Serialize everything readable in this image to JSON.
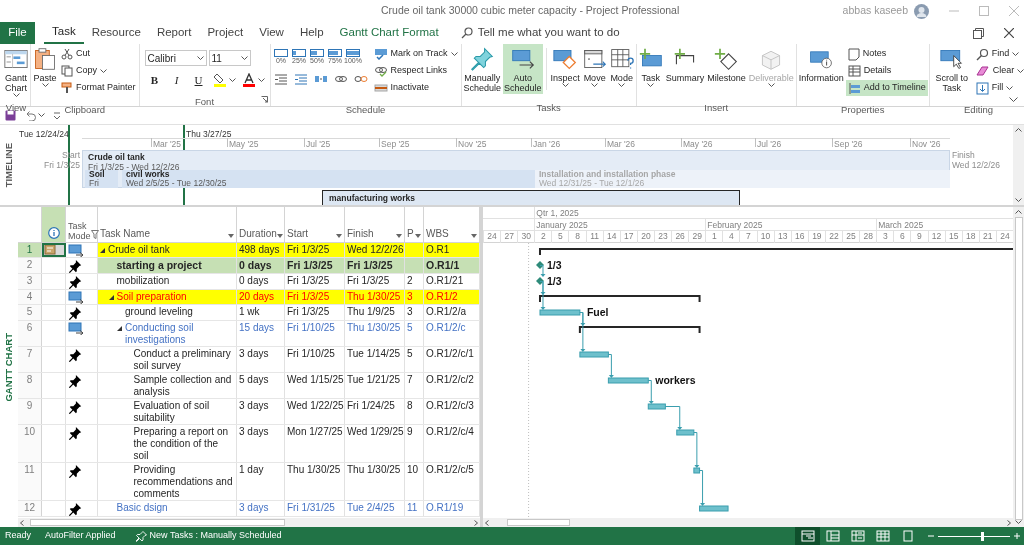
{
  "window": {
    "title": "Crude oil tank 30000 cubic meter capacity - Project Professional",
    "user": "abbas kaseeb"
  },
  "menu_tabs": [
    {
      "label": "File",
      "kind": "file",
      "selected": false
    },
    {
      "label": "Task",
      "kind": "tab",
      "selected": true
    },
    {
      "label": "Resource",
      "kind": "tab",
      "selected": false
    },
    {
      "label": "Report",
      "kind": "tab",
      "selected": false
    },
    {
      "label": "Project",
      "kind": "tab",
      "selected": false
    },
    {
      "label": "View",
      "kind": "tab",
      "selected": false
    },
    {
      "label": "Help",
      "kind": "tab",
      "selected": false
    },
    {
      "label": "Gantt Chart Format",
      "kind": "contextual",
      "selected": false
    }
  ],
  "search": {
    "placeholder": "Tell me what you want to do"
  },
  "ribbon": [
    {
      "kind": "view",
      "label": "View",
      "items": [
        {
          "label": "Gantt Chart",
          "dropdown": true
        }
      ]
    },
    {
      "kind": "clipboard",
      "label": "Clipboard",
      "items": [
        {
          "label": "Paste",
          "dropdown": true
        },
        {
          "label": "Cut",
          "dropdown": false
        },
        {
          "label": "Copy",
          "dropdown": true
        },
        {
          "label": "Format Painter",
          "dropdown": false
        }
      ]
    },
    {
      "kind": "font",
      "label": "Font",
      "font": "Calibri",
      "size": "11",
      "styles": [
        "B",
        "I",
        "U"
      ]
    },
    {
      "kind": "schedule",
      "label": "Schedule",
      "percents": [
        "0%",
        "25%",
        "50%",
        "75%",
        "100%"
      ],
      "items": [
        {
          "label": "Mark on Track",
          "dropdown": true
        },
        {
          "label": "Respect Links",
          "dropdown": false
        },
        {
          "label": "Inactivate",
          "dropdown": false
        }
      ]
    },
    {
      "kind": "tasks",
      "label": "Tasks",
      "items": [
        {
          "label": "Manually Schedule",
          "selected": false
        },
        {
          "label": "Auto Schedule",
          "selected": true
        },
        {
          "label": "Inspect",
          "selected": false,
          "dropdown": true
        },
        {
          "label": "Move",
          "selected": false,
          "dropdown": true
        },
        {
          "label": "Mode",
          "selected": false,
          "dropdown": true
        }
      ]
    },
    {
      "kind": "insert",
      "label": "Insert",
      "items": [
        {
          "label": "Task",
          "disabled": false,
          "dropdown": true
        },
        {
          "label": "Summary",
          "disabled": false,
          "dropdown": false
        },
        {
          "label": "Milestone",
          "disabled": false,
          "dropdown": false
        },
        {
          "label": "Deliverable",
          "disabled": true,
          "dropdown": true
        }
      ]
    },
    {
      "kind": "properties",
      "label": "Properties",
      "items": [
        {
          "label": "Information",
          "selected": false
        },
        {
          "label": "Notes",
          "selected": false
        },
        {
          "label": "Details",
          "selected": false
        },
        {
          "label": "Add to Timeline",
          "selected": true
        }
      ]
    },
    {
      "kind": "editing",
      "label": "Editing",
      "items": [
        {
          "label": "Scroll to Task",
          "dropdown": false
        },
        {
          "label": "Find",
          "dropdown": true
        },
        {
          "label": "Clear",
          "dropdown": true
        },
        {
          "label": "Fill",
          "dropdown": true
        }
      ]
    }
  ],
  "timeline": {
    "label": "TIMELINE",
    "range_start": "Tue 12/24/24",
    "range_end": "Thu 3/27/25",
    "months": [
      "Mar '25",
      "May '25",
      "Jul '25",
      "Sep '25",
      "Nov '25",
      "Jan '26",
      "Mar '26",
      "May '26",
      "Jul '26",
      "Sep '26",
      "Nov '26"
    ],
    "start": {
      "label": "Start",
      "date": "Fri 1/3/25"
    },
    "finish": {
      "label": "Finish",
      "date": "Wed 12/2/26"
    },
    "bars": [
      {
        "kind": "project",
        "name": "Crude oil tank",
        "dates": "Fri 1/3/25 - Wed 12/2/26",
        "dimmed": false
      },
      {
        "kind": "task",
        "name": "Soil",
        "dates": "Fri",
        "dimmed": false
      },
      {
        "kind": "task",
        "name": "civil works",
        "dates": "Wed 2/5/25 - Tue 12/30/25",
        "dimmed": false
      },
      {
        "kind": "task",
        "name": "Installation and installation phase",
        "dates": "Wed 12/31/25 - Tue 12/1/26",
        "dimmed": true
      },
      {
        "kind": "callout",
        "name": "manufacturing works",
        "dimmed": false
      }
    ]
  },
  "view_label": "GANTT CHART",
  "table": {
    "columns": [
      {
        "kind": "indicators",
        "selected": true,
        "filtered": false
      },
      {
        "kind": "mode",
        "label": "Task Mode",
        "selected": false,
        "filtered": true
      },
      {
        "kind": "name",
        "label": "Task Name",
        "selected": false,
        "filtered": false
      },
      {
        "kind": "duration",
        "label": "Duration",
        "selected": false,
        "filtered": false
      },
      {
        "kind": "start",
        "label": "Start",
        "selected": false,
        "filtered": false
      },
      {
        "kind": "finish",
        "label": "Finish",
        "selected": false,
        "filtered": false
      },
      {
        "kind": "pred",
        "label": "P",
        "selected": false,
        "filtered": false
      },
      {
        "kind": "wbs",
        "label": "WBS",
        "selected": false,
        "filtered": false
      }
    ],
    "tasks": [
      {
        "id": "1",
        "manually_scheduled": false,
        "kind": "summary",
        "note": true,
        "selected": true,
        "expanded": true,
        "highlight": {
          "color": "#ffff00"
        },
        "name": "Crude oil tank",
        "duration": "498 days",
        "start": "Fri 1/3/25",
        "finish": "Wed 12/2/26",
        "wbs": "O.R1",
        "children": [
          {
            "id": "2",
            "manually_scheduled": true,
            "kind": "milestone",
            "note": false,
            "selected": false,
            "highlight": {
              "color": "#c6e0b4"
            },
            "bold": true,
            "name": "starting a project",
            "duration": "0 days",
            "start": "Fri 1/3/25",
            "finish": "Fri 1/3/25",
            "wbs": "O.R1/1",
            "bar_label": "1/3"
          },
          {
            "id": "3",
            "manually_scheduled": true,
            "kind": "milestone",
            "note": false,
            "selected": false,
            "name": "mobilization",
            "duration": "0 days",
            "start": "Fri 1/3/25",
            "finish": "Fri 1/3/25",
            "predecessors": "2",
            "wbs": "O.R1/21",
            "bar_label": "1/3"
          },
          {
            "id": "4",
            "manually_scheduled": false,
            "kind": "summary",
            "note": false,
            "selected": false,
            "expanded": true,
            "highlight": {
              "color": "#ffff00"
            },
            "font": {
              "color": "#ff0000"
            },
            "name": "Soil preparation",
            "duration": "20 days",
            "start": "Fri 1/3/25",
            "finish": "Thu 1/30/25",
            "predecessors": "3",
            "wbs": "O.R1/2",
            "children": [
              {
                "id": "5",
                "manually_scheduled": true,
                "kind": "task",
                "note": false,
                "selected": false,
                "name": "ground leveling",
                "duration": "1 wk",
                "start": "Fri 1/3/25",
                "finish": "Thu 1/9/25",
                "predecessors": "3",
                "wbs": "O.R1/2/a",
                "bar_label": "Fuel"
              },
              {
                "id": "6",
                "manually_scheduled": false,
                "kind": "summary",
                "note": false,
                "selected": false,
                "expanded": true,
                "font": {
                  "color": "#4472c4"
                },
                "name": "Conducting soil investigations",
                "duration": "15 days",
                "start": "Fri 1/10/25",
                "finish": "Thu 1/30/25",
                "predecessors": "5",
                "wbs": "O.R1/2/c",
                "children": [
                  {
                    "id": "7",
                    "manually_scheduled": true,
                    "kind": "task",
                    "note": false,
                    "selected": false,
                    "name": "Conduct a preliminary soil survey",
                    "duration": "3 days",
                    "start": "Fri 1/10/25",
                    "finish": "Tue 1/14/25",
                    "predecessors": "5",
                    "wbs": "O.R1/2/c/1"
                  },
                  {
                    "id": "8",
                    "manually_scheduled": true,
                    "kind": "task",
                    "note": false,
                    "selected": false,
                    "name": "Sample collection and analysis",
                    "duration": "5 days",
                    "start": "Wed 1/15/25",
                    "finish": "Tue 1/21/25",
                    "predecessors": "7",
                    "wbs": "O.R1/2/c/2",
                    "bar_label": "workers"
                  },
                  {
                    "id": "9",
                    "manually_scheduled": true,
                    "kind": "task",
                    "note": false,
                    "selected": false,
                    "name": "Evaluation of soil suitability",
                    "duration": "3 days",
                    "start": "Wed 1/22/25",
                    "finish": "Fri 1/24/25",
                    "predecessors": "8",
                    "wbs": "O.R1/2/c/3"
                  },
                  {
                    "id": "10",
                    "manually_scheduled": true,
                    "kind": "task",
                    "note": false,
                    "selected": false,
                    "name": "Preparing a report on the condition of the soil",
                    "duration": "3 days",
                    "start": "Mon 1/27/25",
                    "finish": "Wed 1/29/25",
                    "predecessors": "9",
                    "wbs": "O.R1/2/c/4"
                  },
                  {
                    "id": "11",
                    "manually_scheduled": true,
                    "kind": "task",
                    "note": false,
                    "selected": false,
                    "name": "Providing recommendations and comments",
                    "duration": "1 day",
                    "start": "Thu 1/30/25",
                    "finish": "Thu 1/30/25",
                    "predecessors": "10",
                    "wbs": "O.R1/2/c/5"
                  }
                ]
              }
            ]
          },
          {
            "id": "12",
            "manually_scheduled": true,
            "kind": "task",
            "note": false,
            "selected": false,
            "font": {
              "color": "#4472c4"
            },
            "name": "Basic dsign",
            "duration": "3 days",
            "start": "Fri 1/31/25",
            "finish": "Tue 2/4/25",
            "predecessors": "11",
            "wbs": "O.R1/19"
          }
        ]
      }
    ]
  },
  "gantt": {
    "quarter": "Qtr 1, 2025",
    "months": [
      "January 2025",
      "February 2025",
      "March 2025"
    ],
    "days": [
      "24",
      "27",
      "30",
      "2",
      "5",
      "8",
      "11",
      "14",
      "17",
      "20",
      "23",
      "26",
      "29",
      "1",
      "4",
      "7",
      "10",
      "13",
      "16",
      "19",
      "22",
      "25",
      "28",
      "3",
      "6",
      "9",
      "12",
      "15",
      "18",
      "21",
      "24"
    ]
  },
  "status_bar": {
    "texts": [
      {
        "text": "Ready",
        "kind": "plain"
      },
      {
        "text": "AutoFilter Applied",
        "kind": "plain"
      },
      {
        "text": "New Tasks : Manually Scheduled",
        "kind": "mode"
      }
    ],
    "views": [
      {
        "selected": true
      },
      {
        "selected": false
      },
      {
        "selected": false
      },
      {
        "selected": false
      },
      {
        "selected": false
      }
    ],
    "zoom": {
      "level": 0.62
    }
  }
}
